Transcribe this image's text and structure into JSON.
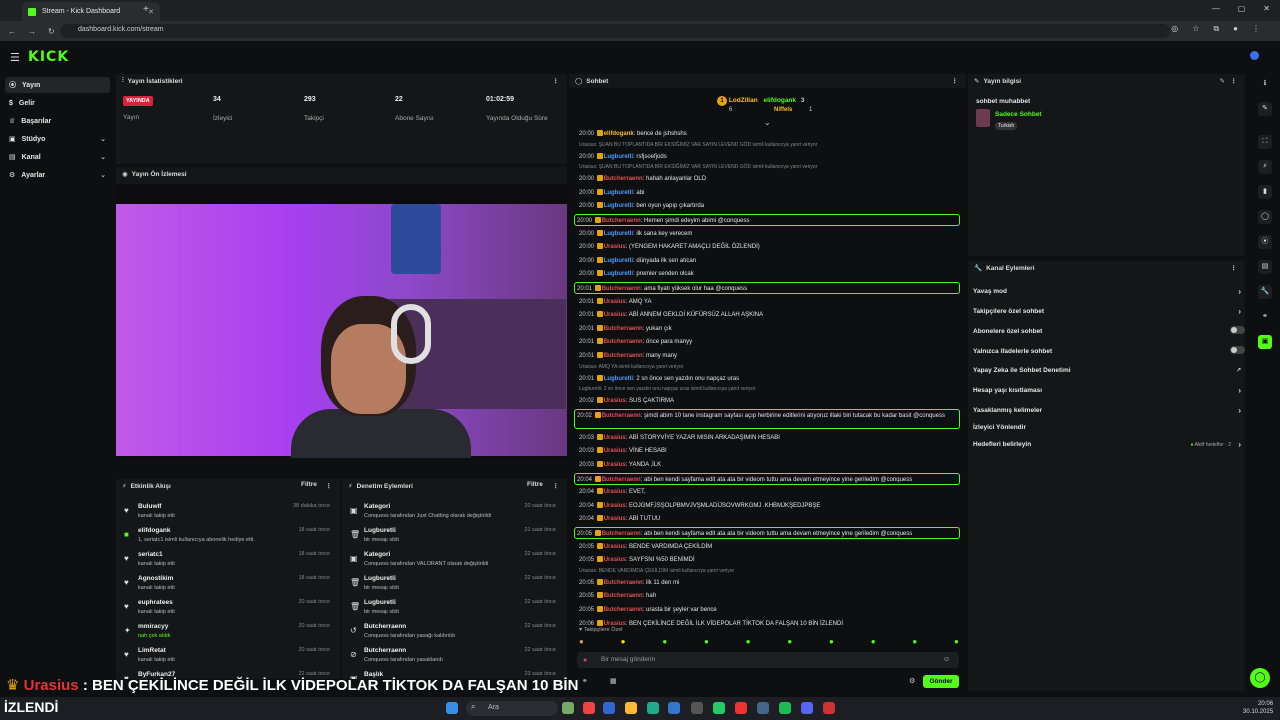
{
  "browser": {
    "tab_title": "Stream - Kick Dashboard",
    "url": "dashboard.kick.com/stream"
  },
  "brand": {
    "logo": "KICK",
    "accent": "#53fc18"
  },
  "sidebar": {
    "items": [
      {
        "label": "Yayın",
        "active": true
      },
      {
        "label": "Gelir"
      },
      {
        "label": "Başarılar"
      },
      {
        "label": "Stüdyo",
        "expandable": true
      },
      {
        "label": "Kanal",
        "expandable": true
      },
      {
        "label": "Ayarlar",
        "expandable": true
      }
    ]
  },
  "stats": {
    "title": "Yayın İstatistikleri",
    "live_badge": "YAYINDA",
    "stream_label": "Yayın",
    "items": [
      {
        "value": "34",
        "label": "İzleyici"
      },
      {
        "value": "293",
        "label": "Takipçi"
      },
      {
        "value": "22",
        "label": "Abone Sayısı"
      },
      {
        "value": "01:02:59",
        "label": "Yayında Olduğu Süre"
      }
    ]
  },
  "preview": {
    "title": "Yayın Ön İzlemesi"
  },
  "activity": {
    "title": "Etkinlik Akışı",
    "filter": "Filtre",
    "items": [
      {
        "name": "Buluwlf",
        "desc": "kanalı takip etti",
        "time": "38 dakika önce"
      },
      {
        "name": "elifdogank",
        "desc": "1, seriatc1 isimli kullanıcıya abonelik hediye etti.",
        "time": "18 saat önce"
      },
      {
        "name": "seriatc1",
        "desc": "kanalı takip etti",
        "time": "18 saat önce"
      },
      {
        "name": "Agnostikim",
        "desc": "kanalı takip etti",
        "time": "18 saat önce"
      },
      {
        "name": "euphratees",
        "desc": "kanalı takip etti",
        "time": "20 saat önce"
      },
      {
        "name": "mmiracyy",
        "desc": "nah çek atıldı",
        "time": "20 saat önce"
      },
      {
        "name": "LimRetat",
        "desc": "kanalı takip etti",
        "time": "20 saat önce"
      },
      {
        "name": "ByFurkan27",
        "desc": "",
        "time": "22 saat önce"
      }
    ]
  },
  "moderation": {
    "title": "Denetim Eylemleri",
    "filter": "Filtre",
    "items": [
      {
        "name": "Kategori",
        "desc": "Conquess tarafından Just Chatting olarak değiştirildi",
        "time": "20 saat önce"
      },
      {
        "name": "Lugburetli",
        "desc": "bir mesajı sildi",
        "time": "21 saat önce"
      },
      {
        "name": "Kategori",
        "desc": "Conquess tarafından VALORANT olarak değiştirildi",
        "time": "22 saat önce"
      },
      {
        "name": "Lugburetli",
        "desc": "bir mesajı sildi",
        "time": "22 saat önce"
      },
      {
        "name": "Lugburetli",
        "desc": "bir mesajı sildi",
        "time": "22 saat önce"
      },
      {
        "name": "Butcherraenn",
        "desc": "Conquess tarafından yasağı kaldırıldı",
        "time": "22 saat önce"
      },
      {
        "name": "Butcherraenn",
        "desc": "Conquess tarafından yasaklandı",
        "time": "22 saat önce"
      },
      {
        "name": "Başlık",
        "desc": "",
        "time": "23 saat önce"
      }
    ]
  },
  "chat": {
    "title": "Sohbet",
    "leaders": [
      {
        "rank": "1",
        "name": "LodZillan",
        "count": "6"
      },
      {
        "name": "elifdogank",
        "count": "3"
      },
      {
        "name": "Niffels",
        "count": "1"
      }
    ],
    "messages": [
      {
        "ts": "20:00",
        "user": "elifdogank",
        "color": "#fbbf24",
        "text": ": bence de jshshshs"
      },
      {
        "reply": "Urasius: ŞUAN BU TOPLANTIDA BİR EKSİĞİMİZ VAR SAYIN LEVEND GÖD isimli kullanıcıya yanıt veriyor"
      },
      {
        "ts": "20:00",
        "user": "Lugburetli",
        "color": "#4f9bff",
        "text": ": rsfjsoefjods"
      },
      {
        "reply": "Urasius: ŞUAN BU TOPLANTIDA BİR EKSİĞİMİZ VAR SAYIN LEVEND GÖD isimli kullanıcıya yanıt veriyor"
      },
      {
        "ts": "20:00",
        "user": "Butcherraenn",
        "color": "#e05252",
        "text": ": hahah anlayanlar OLD"
      },
      {
        "ts": "20:00",
        "user": "Lugburetli",
        "color": "#4f9bff",
        "text": ": abi"
      },
      {
        "ts": "20:00",
        "user": "Lugburetli",
        "color": "#4f9bff",
        "text": ": ben oyun yapıp çıkartırda"
      },
      {
        "ts": "20:00",
        "user": "Butcherraenn",
        "color": "#e05252",
        "text": ": Hemen şimdi edeyim abimi @conquess",
        "hl": true
      },
      {
        "ts": "20:00",
        "user": "Lugburetli",
        "color": "#4f9bff",
        "text": ": ilk sana key verecem"
      },
      {
        "ts": "20:00",
        "user": "Urasius",
        "color": "#e05252",
        "text": ": (YENGEM HAKARET AMAÇLI DEĞİL ÖZLENDİ)"
      },
      {
        "ts": "20:00",
        "user": "Lugburetli",
        "color": "#4f9bff",
        "text": ": dünyada ilk sen atıcan"
      },
      {
        "ts": "20:00",
        "user": "Lugburetli",
        "color": "#4f9bff",
        "text": ": premier senden olcak"
      },
      {
        "ts": "20:01",
        "user": "Butcherraenn",
        "color": "#e05252",
        "text": ": ama fiyatı yüksek olur haa @conquess",
        "hl": true
      },
      {
        "ts": "20:01",
        "user": "Urasius",
        "color": "#e05252",
        "text": ": AMQ YA"
      },
      {
        "ts": "20:01",
        "user": "Urasius",
        "color": "#e05252",
        "text": ": ABİ ANNEM GEKLDİ KÜFÜRSÜZ ALLAH AŞKINA"
      },
      {
        "ts": "20:01",
        "user": "Butcherraenn",
        "color": "#e05252",
        "text": ": yukarı çık"
      },
      {
        "ts": "20:01",
        "user": "Butcherraenn",
        "color": "#e05252",
        "text": ": önce para manyy"
      },
      {
        "ts": "20:01",
        "user": "Butcherraenn",
        "color": "#e05252",
        "text": ": many many"
      },
      {
        "reply": "Urasius: AMQ YA isimli kullanıcıya yanıt veriyor"
      },
      {
        "ts": "20:01",
        "user": "Lugburetli",
        "color": "#4f9bff",
        "text": ": 2 sn önce sen yazdın onu napçaz uras"
      },
      {
        "reply": "Lugburetli: 2 sn önce sen yazdın onu napçaz uras isimli kullanıcıya yanıt veriyor"
      },
      {
        "ts": "20:02",
        "user": "Urasius",
        "color": "#e05252",
        "text": ": SUS ÇAKTIRMA"
      },
      {
        "ts": "20:02",
        "user": "Butcherraenn",
        "color": "#e05252",
        "text": ": şimdi abim 10 tane instagram sayfası açıp herbirine editlerini atıyoruz illaki biri tutacak bu kadar basit @conquess",
        "hl": true,
        "tall": true
      },
      {
        "ts": "20:03",
        "user": "Urasius",
        "color": "#e05252",
        "text": ": ABİ STORYVİYE YAZAR MISIN ARKADAŞIMIN HESABI"
      },
      {
        "ts": "20:03",
        "user": "Urasius",
        "color": "#e05252",
        "text": ": VİNE HESABI"
      },
      {
        "ts": "20:03",
        "user": "Urasius",
        "color": "#e05252",
        "text": ": YANDA ,İLK"
      },
      {
        "ts": "20:04",
        "user": "Butcherraenn",
        "color": "#e05252",
        "text": ": abi ben kendi sayfama edit ata ata bir videom tuttu ama devam etmeyince yine geriledim @conquess",
        "hl": true
      },
      {
        "ts": "20:04",
        "user": "Urasius",
        "color": "#e05252",
        "text": ": EVET,"
      },
      {
        "ts": "20:04",
        "user": "Urasius",
        "color": "#e05252",
        "text": ": EOJGMF,İSŞOLPBMVJVŞMLADİJSOVWRKGMJ .KHBMJKŞEDJPBŞE"
      },
      {
        "ts": "20:04",
        "user": "Urasius",
        "color": "#e05252",
        "text": ": ABİ TUTUU"
      },
      {
        "ts": "20:05",
        "user": "Butcherraenn",
        "color": "#e05252",
        "text": ": abi ben kendi sayfama edit ata ata bir videom tuttu ama devam etmeyince yine geriledim @conquess",
        "hl": true
      },
      {
        "ts": "20:05",
        "user": "Urasius",
        "color": "#e05252",
        "text": ": BENDE VARDIMDA ÇEKİLDİM"
      },
      {
        "ts": "20:05",
        "user": "Urasius",
        "color": "#e05252",
        "text": ": SAYFSNI %50 BENİMDİ"
      },
      {
        "reply": "Urasius: BENDE VARDIMDA ÇEKİLDİM isimli kullanıcıya yanıt veriyor"
      },
      {
        "ts": "20:05",
        "user": "Butcherraenn",
        "color": "#e05252",
        "text": ": ilk 11 den mi"
      },
      {
        "ts": "20:05",
        "user": "Butcherraenn",
        "color": "#e05252",
        "text": ": hah"
      },
      {
        "ts": "20:05",
        "user": "Butcherraenn",
        "color": "#e05252",
        "text": ": urasta bir şeyler var bence"
      },
      {
        "ts": "20:06",
        "user": "Urasius",
        "color": "#e05252",
        "text": ": BEN ÇEKİLİNCE DEĞİL İLK VİDEPOLAR TİKTOK DA FALŞAN 10 BİN İZLENDİ"
      }
    ],
    "followers_only": "Takipçilere Özel",
    "input_placeholder": "Bir mesaj gönderin",
    "send": "Gönder"
  },
  "stream_info": {
    "title": "Yayın bilgisi",
    "stream_title": "sohbet muhabbet",
    "category": "Sadece Sohbet",
    "tag": "Turkish"
  },
  "channel_actions": {
    "title": "Kanal Eylemleri",
    "items": [
      {
        "label": "Yavaş mod",
        "type": "chevron"
      },
      {
        "label": "Takipçilere özel sohbet",
        "type": "chevron"
      },
      {
        "label": "Abonelere özel sohbet",
        "type": "toggle"
      },
      {
        "label": "Yalnızca ifadelerle sohbet",
        "type": "toggle"
      },
      {
        "label": "Yapay Zeka ile Sohbet Denetimi",
        "type": "external"
      },
      {
        "label": "Hesap yaşı kısıtlaması",
        "type": "chevron"
      },
      {
        "label": "Yasaklanmış kelimeler",
        "type": "chevron"
      },
      {
        "label": "İzleyici Yönlendir",
        "type": "none"
      },
      {
        "label": "Hedefleri belirleyin",
        "type": "chevron",
        "extra": "Aktif hedefler · 2"
      }
    ]
  },
  "overlay": {
    "subtitle_name": "Urasius",
    "subtitle_text": " : BEN ÇEKİLİNCE DEĞİL İLK VİDEPOLAR TİKTOK DA FALŞAN 10 BİN",
    "subtitle_line2": "İZLENDİ"
  },
  "taskbar": {
    "search": "Ara",
    "time": "20:06",
    "date": "30.10.2025"
  }
}
